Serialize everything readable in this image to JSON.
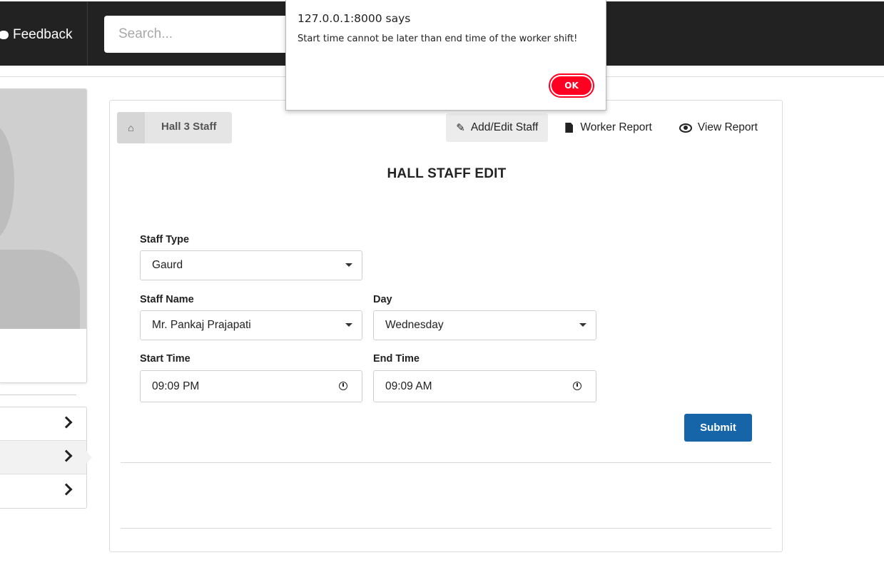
{
  "header": {
    "feedback_label": "Feedback",
    "search_placeholder": "Search..."
  },
  "sidebar": {
    "items": [
      {
        "icon": "chevron-right-icon"
      },
      {
        "icon": "chevron-right-icon"
      },
      {
        "icon": "chevron-right-icon"
      }
    ]
  },
  "main": {
    "breadcrumb": {
      "icon": "home-icon",
      "label": "Hall 3 Staff"
    },
    "tabs": [
      {
        "label": "Add/Edit Staff",
        "icon": "edit-icon"
      },
      {
        "label": "Worker Report",
        "icon": "document-icon"
      },
      {
        "label": "View Report",
        "icon": "eye-icon"
      }
    ],
    "title": "HALL STAFF EDIT",
    "form": {
      "staff_type": {
        "label": "Staff Type",
        "value": "Gaurd"
      },
      "staff_name": {
        "label": "Staff Name",
        "value": "Mr. Pankaj Prajapati"
      },
      "day": {
        "label": "Day",
        "value": "Wednesday"
      },
      "start_time": {
        "label": "Start Time",
        "value": "09:09 PM"
      },
      "end_time": {
        "label": "End Time",
        "value": "09:09 AM"
      },
      "submit_label": "Submit"
    }
  },
  "alert": {
    "origin": "127.0.0.1:8000 says",
    "message": "Start time cannot be later than end time of the worker shift!",
    "ok_label": "OK",
    "ok_color": "#ff0022"
  }
}
